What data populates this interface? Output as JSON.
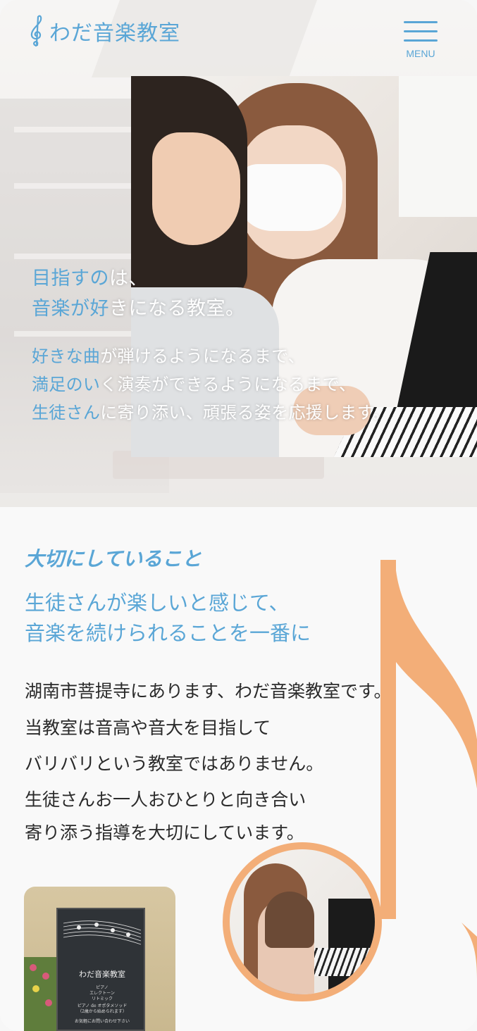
{
  "header": {
    "logo_text": "わだ音楽教室",
    "menu_label": "MENU"
  },
  "hero": {
    "headline": [
      "目指すのは、",
      "音楽が好きになる教室。"
    ],
    "sub": [
      "好きな曲が弾けるようになるまで、",
      "満足のいく演奏ができるようになるまで、",
      "生徒さんに寄り添い、頑張る姿を応援します。"
    ]
  },
  "about": {
    "section_title": "大切にしていること",
    "catch": [
      "生徒さんが楽しいと感じて、",
      "音楽を続けられることを一番に"
    ],
    "body": [
      "湖南市菩提寺にあります、わだ音楽教室です。",
      "当教室は音高や音大を目指して",
      "バリバリという教室ではありません。",
      "生徒さんお一人おひとりと向き合い",
      "寄り添う指導を大切にしています。"
    ]
  },
  "sign": {
    "title": "わだ音楽教室",
    "lines": [
      "ピアノ",
      "エレクトーン",
      "リトミック",
      "ピアノ de オポタメソッド",
      "（2歳から始められます）",
      "お気軽にお問い合わせ下さい"
    ]
  },
  "colors": {
    "accent_blue": "#5aa6d6",
    "accent_orange": "#f3ae78",
    "text_dark": "#2a2a2a"
  },
  "icons": {
    "logo": "treble-clef-icon",
    "menu": "hamburger-menu-icon",
    "decoration": "music-note-icon"
  }
}
